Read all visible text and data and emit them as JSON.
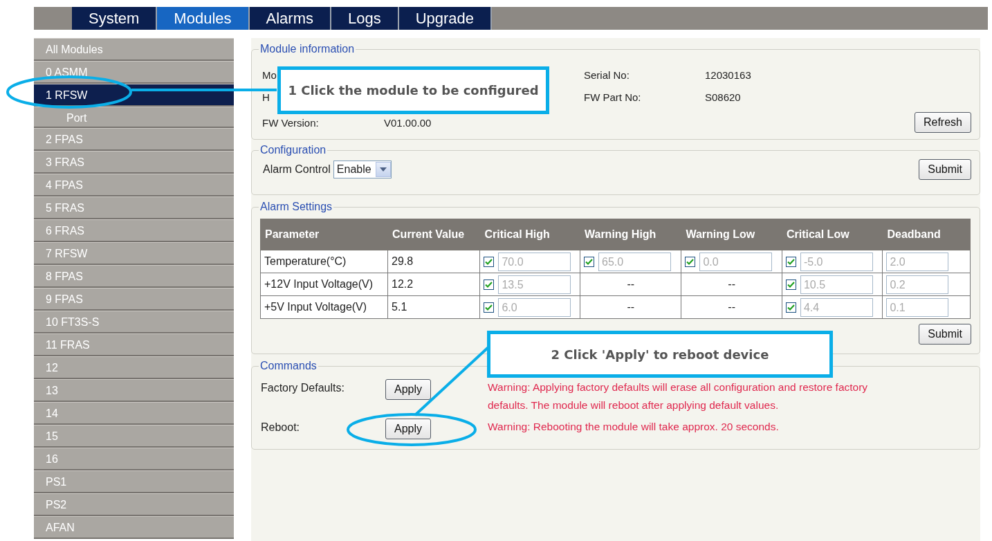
{
  "tabs": [
    {
      "label": "System",
      "selected": false
    },
    {
      "label": "Modules",
      "selected": true
    },
    {
      "label": "Alarms",
      "selected": false
    },
    {
      "label": "Logs",
      "selected": false
    },
    {
      "label": "Upgrade",
      "selected": false
    }
  ],
  "sidebar": {
    "items": [
      {
        "label": "All Modules",
        "selected": false
      },
      {
        "label": "0 ASMM",
        "selected": false
      },
      {
        "label": "1 RFSW",
        "selected": true,
        "children": [
          {
            "label": "Port",
            "selected": false
          }
        ]
      },
      {
        "label": "2 FPAS",
        "selected": false
      },
      {
        "label": "3 FRAS",
        "selected": false
      },
      {
        "label": "4 FPAS",
        "selected": false
      },
      {
        "label": "5 FRAS",
        "selected": false
      },
      {
        "label": "6 FRAS",
        "selected": false
      },
      {
        "label": "7 RFSW",
        "selected": false
      },
      {
        "label": "8 FPAS",
        "selected": false
      },
      {
        "label": "9 FPAS",
        "selected": false
      },
      {
        "label": "10 FT3S-S",
        "selected": false
      },
      {
        "label": "11 FRAS",
        "selected": false
      },
      {
        "label": "12",
        "selected": false
      },
      {
        "label": "13",
        "selected": false
      },
      {
        "label": "14",
        "selected": false
      },
      {
        "label": "15",
        "selected": false
      },
      {
        "label": "16",
        "selected": false
      },
      {
        "label": "PS1",
        "selected": false
      },
      {
        "label": "PS2",
        "selected": false
      },
      {
        "label": "AFAN",
        "selected": false
      }
    ]
  },
  "module_information": {
    "title": "Module information",
    "rows": [
      [
        {
          "label": "Mo"
        },
        {
          "label": "Serial No:",
          "value": "12030163"
        }
      ],
      [
        {
          "label": "H"
        },
        {
          "label": "FW Part No:",
          "value": "S08620"
        }
      ],
      [
        {
          "label": "FW Version:",
          "value": "V01.00.00"
        }
      ]
    ],
    "button": "Refresh"
  },
  "configuration": {
    "title": "Configuration",
    "label": "Alarm Control",
    "value": "Enable",
    "button": "Submit"
  },
  "alarm_settings": {
    "title": "Alarm Settings",
    "columns": [
      "Parameter",
      "Current Value",
      "Critical High",
      "Warning High",
      "Warning Low",
      "Critical Low",
      "Deadband"
    ],
    "rows": [
      {
        "cells": [
          {
            "kind": "text",
            "value": "Temperature(°C)"
          },
          {
            "kind": "text",
            "value": "29.8"
          },
          {
            "kind": "check",
            "checked": true,
            "value": "70.0"
          },
          {
            "kind": "check",
            "checked": true,
            "value": "65.0"
          },
          {
            "kind": "check",
            "checked": true,
            "value": "0.0"
          },
          {
            "kind": "check",
            "checked": true,
            "value": "-5.0"
          },
          {
            "kind": "field",
            "value": "2.0"
          }
        ]
      },
      {
        "cells": [
          {
            "kind": "text",
            "value": "+12V Input Voltage(V)"
          },
          {
            "kind": "text",
            "value": "12.2"
          },
          {
            "kind": "check",
            "checked": true,
            "value": "13.5"
          },
          {
            "kind": "dash",
            "value": "--"
          },
          {
            "kind": "dash",
            "value": "--"
          },
          {
            "kind": "check",
            "checked": true,
            "value": "10.5"
          },
          {
            "kind": "field",
            "value": "0.2"
          }
        ]
      },
      {
        "cells": [
          {
            "kind": "text",
            "value": "+5V Input Voltage(V)"
          },
          {
            "kind": "text",
            "value": "5.1"
          },
          {
            "kind": "check",
            "checked": true,
            "value": "6.0"
          },
          {
            "kind": "dash",
            "value": "--"
          },
          {
            "kind": "dash",
            "value": "--"
          },
          {
            "kind": "check",
            "checked": true,
            "value": "4.4"
          },
          {
            "kind": "field",
            "value": "0.1"
          }
        ]
      }
    ],
    "button": "Submit"
  },
  "commands": {
    "title": "Commands",
    "rows": [
      {
        "label": "Factory Defaults:",
        "button": "Apply",
        "warning": "Warning: Applying factory defaults will erase all configuration and restore factory defaults. The module will reboot after applying default values."
      },
      {
        "label": "Reboot:",
        "button": "Apply",
        "warning": "Warning: Rebooting the module will take approx. 20 seconds."
      }
    ]
  },
  "callouts": [
    "1 Click the module to be configured",
    "2 Click 'Apply' to reboot device"
  ]
}
